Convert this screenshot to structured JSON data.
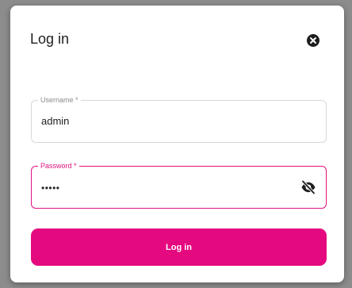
{
  "dialog": {
    "title": "Log in",
    "close_icon": "close-circle-icon"
  },
  "username": {
    "label": "Username *",
    "value": "admin"
  },
  "password": {
    "label": "Password *",
    "value": "•••••",
    "toggle_icon": "eye-off-icon"
  },
  "submit": {
    "label": "Log in"
  },
  "colors": {
    "accent": "#e5097f",
    "backdrop": "#8c8c8c",
    "dialog_bg": "#ffffff"
  }
}
